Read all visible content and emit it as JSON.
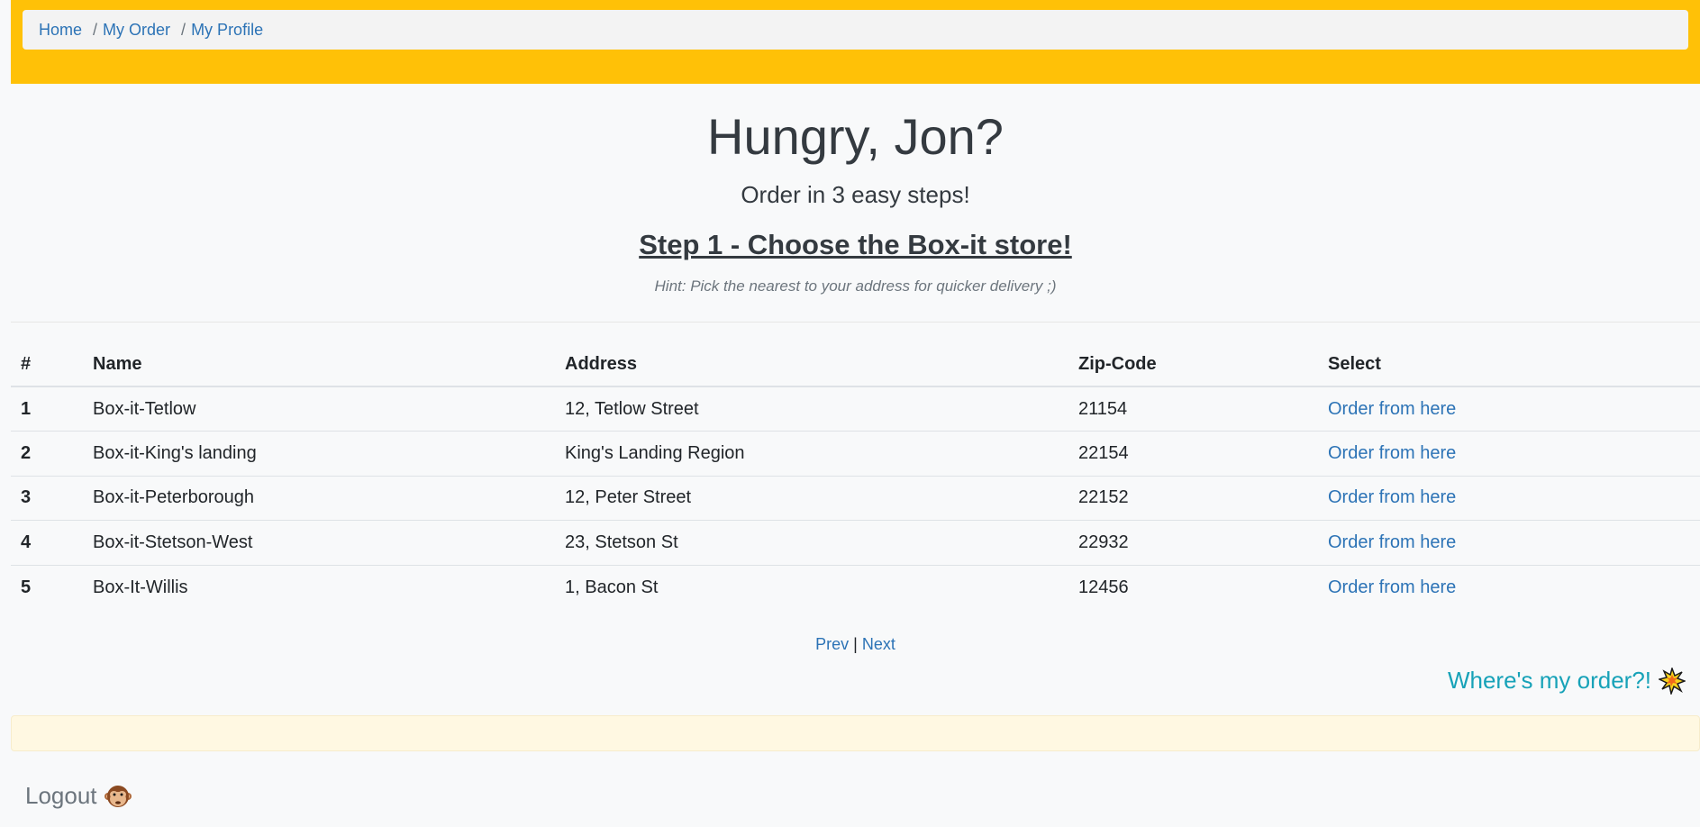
{
  "breadcrumb": {
    "items": [
      "Home",
      "My Order",
      "My Profile"
    ],
    "separator": "/"
  },
  "hero": {
    "title": "Hungry, Jon?",
    "subtitle": "Order in 3 easy steps!",
    "step": "Step 1 - Choose the Box-it store!",
    "hint": "Hint: Pick the nearest to your address for quicker delivery ;)"
  },
  "table": {
    "headers": [
      "#",
      "Name",
      "Address",
      "Zip-Code",
      "Select"
    ],
    "rows": [
      {
        "num": "1",
        "name": "Box-it-Tetlow",
        "address": "12, Tetlow Street",
        "zip": "21154",
        "action": "Order from here"
      },
      {
        "num": "2",
        "name": "Box-it-King's landing",
        "address": "King's Landing Region",
        "zip": "22154",
        "action": "Order from here"
      },
      {
        "num": "3",
        "name": "Box-it-Peterborough",
        "address": "12, Peter Street",
        "zip": "22152",
        "action": "Order from here"
      },
      {
        "num": "4",
        "name": "Box-it-Stetson-West",
        "address": "23, Stetson St",
        "zip": "22932",
        "action": "Order from here"
      },
      {
        "num": "5",
        "name": "Box-It-Willis",
        "address": "1, Bacon St",
        "zip": "12456",
        "action": "Order from here"
      }
    ]
  },
  "pager": {
    "prev": "Prev",
    "separator": "|",
    "next": "Next"
  },
  "where_link": {
    "label": "Where's my order?!",
    "icon": "collision-icon"
  },
  "logout": {
    "label": "Logout",
    "icon": "monkey-face-icon"
  },
  "colors": {
    "header_bar": "#ffc107",
    "link": "#2c73b6",
    "teal_link": "#17a2b8",
    "alert_bg": "#fff8e2"
  }
}
